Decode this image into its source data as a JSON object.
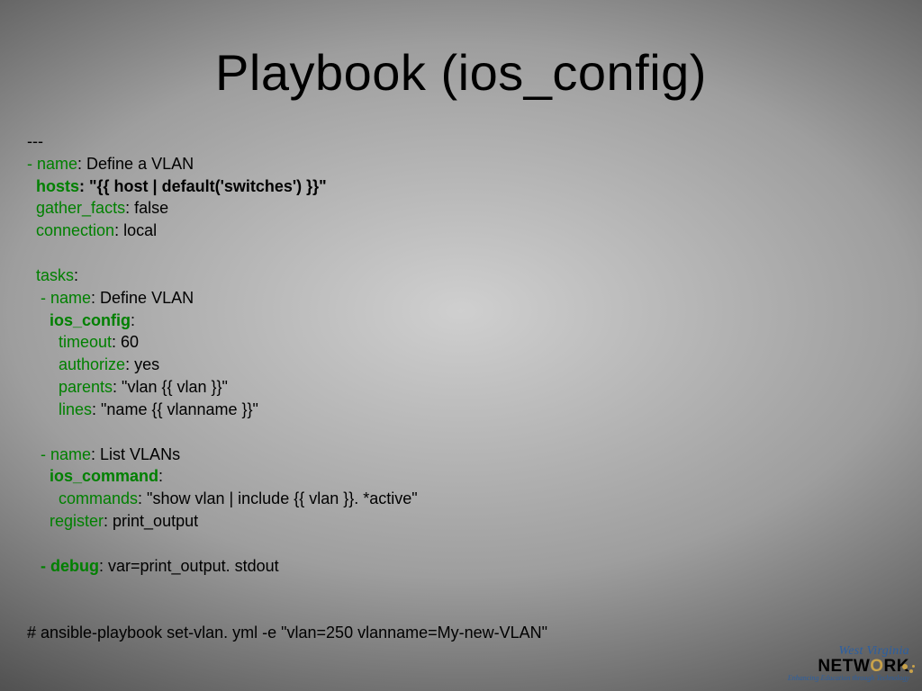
{
  "title": "Playbook (ios_config)",
  "code": {
    "l1": "---",
    "l2_k": "- name",
    "l2_v": ": Define a VLAN",
    "l3_k": "  hosts",
    "l3_v": ": \"{{ host | default('switches') }}\"",
    "l4_k": "  gather_facts",
    "l4_v": ": false",
    "l5_k": "  connection",
    "l5_v": ": local",
    "blank1": "",
    "l6_k": "  tasks",
    "l6_v": ":",
    "l7_k": "   - name",
    "l7_v": ": Define VLAN",
    "l8_k": "     ios_config",
    "l8_v": ":",
    "l9_k": "       timeout",
    "l9_v": ": 60",
    "l10_k": "       authorize",
    "l10_v": ": yes",
    "l11_k": "       parents",
    "l11_v": ": \"vlan {{ vlan }}\"",
    "l12_k": "       lines",
    "l12_v": ": \"name {{ vlanname }}\"",
    "blank2": "",
    "l13_k": "   - name",
    "l13_v": ": List VLANs",
    "l14_k": "     ios_command",
    "l14_v": ":",
    "l15_k": "       commands",
    "l15_v": ": \"show vlan | include {{ vlan }}. *active\"",
    "l16_k": "     register",
    "l16_v": ": print_output",
    "blank3": "",
    "l17_k": "   - debug",
    "l17_v": ": var=print_output. stdout"
  },
  "footer_cmd": "# ansible-playbook set-vlan. yml -e \"vlan=250 vlanname=My-new-VLAN\"",
  "logo": {
    "line1": "West Virginia",
    "line2_a": "NETW",
    "line2_b": "O",
    "line2_c": "RK",
    "tagline": "Enhancing Education through Technology"
  }
}
